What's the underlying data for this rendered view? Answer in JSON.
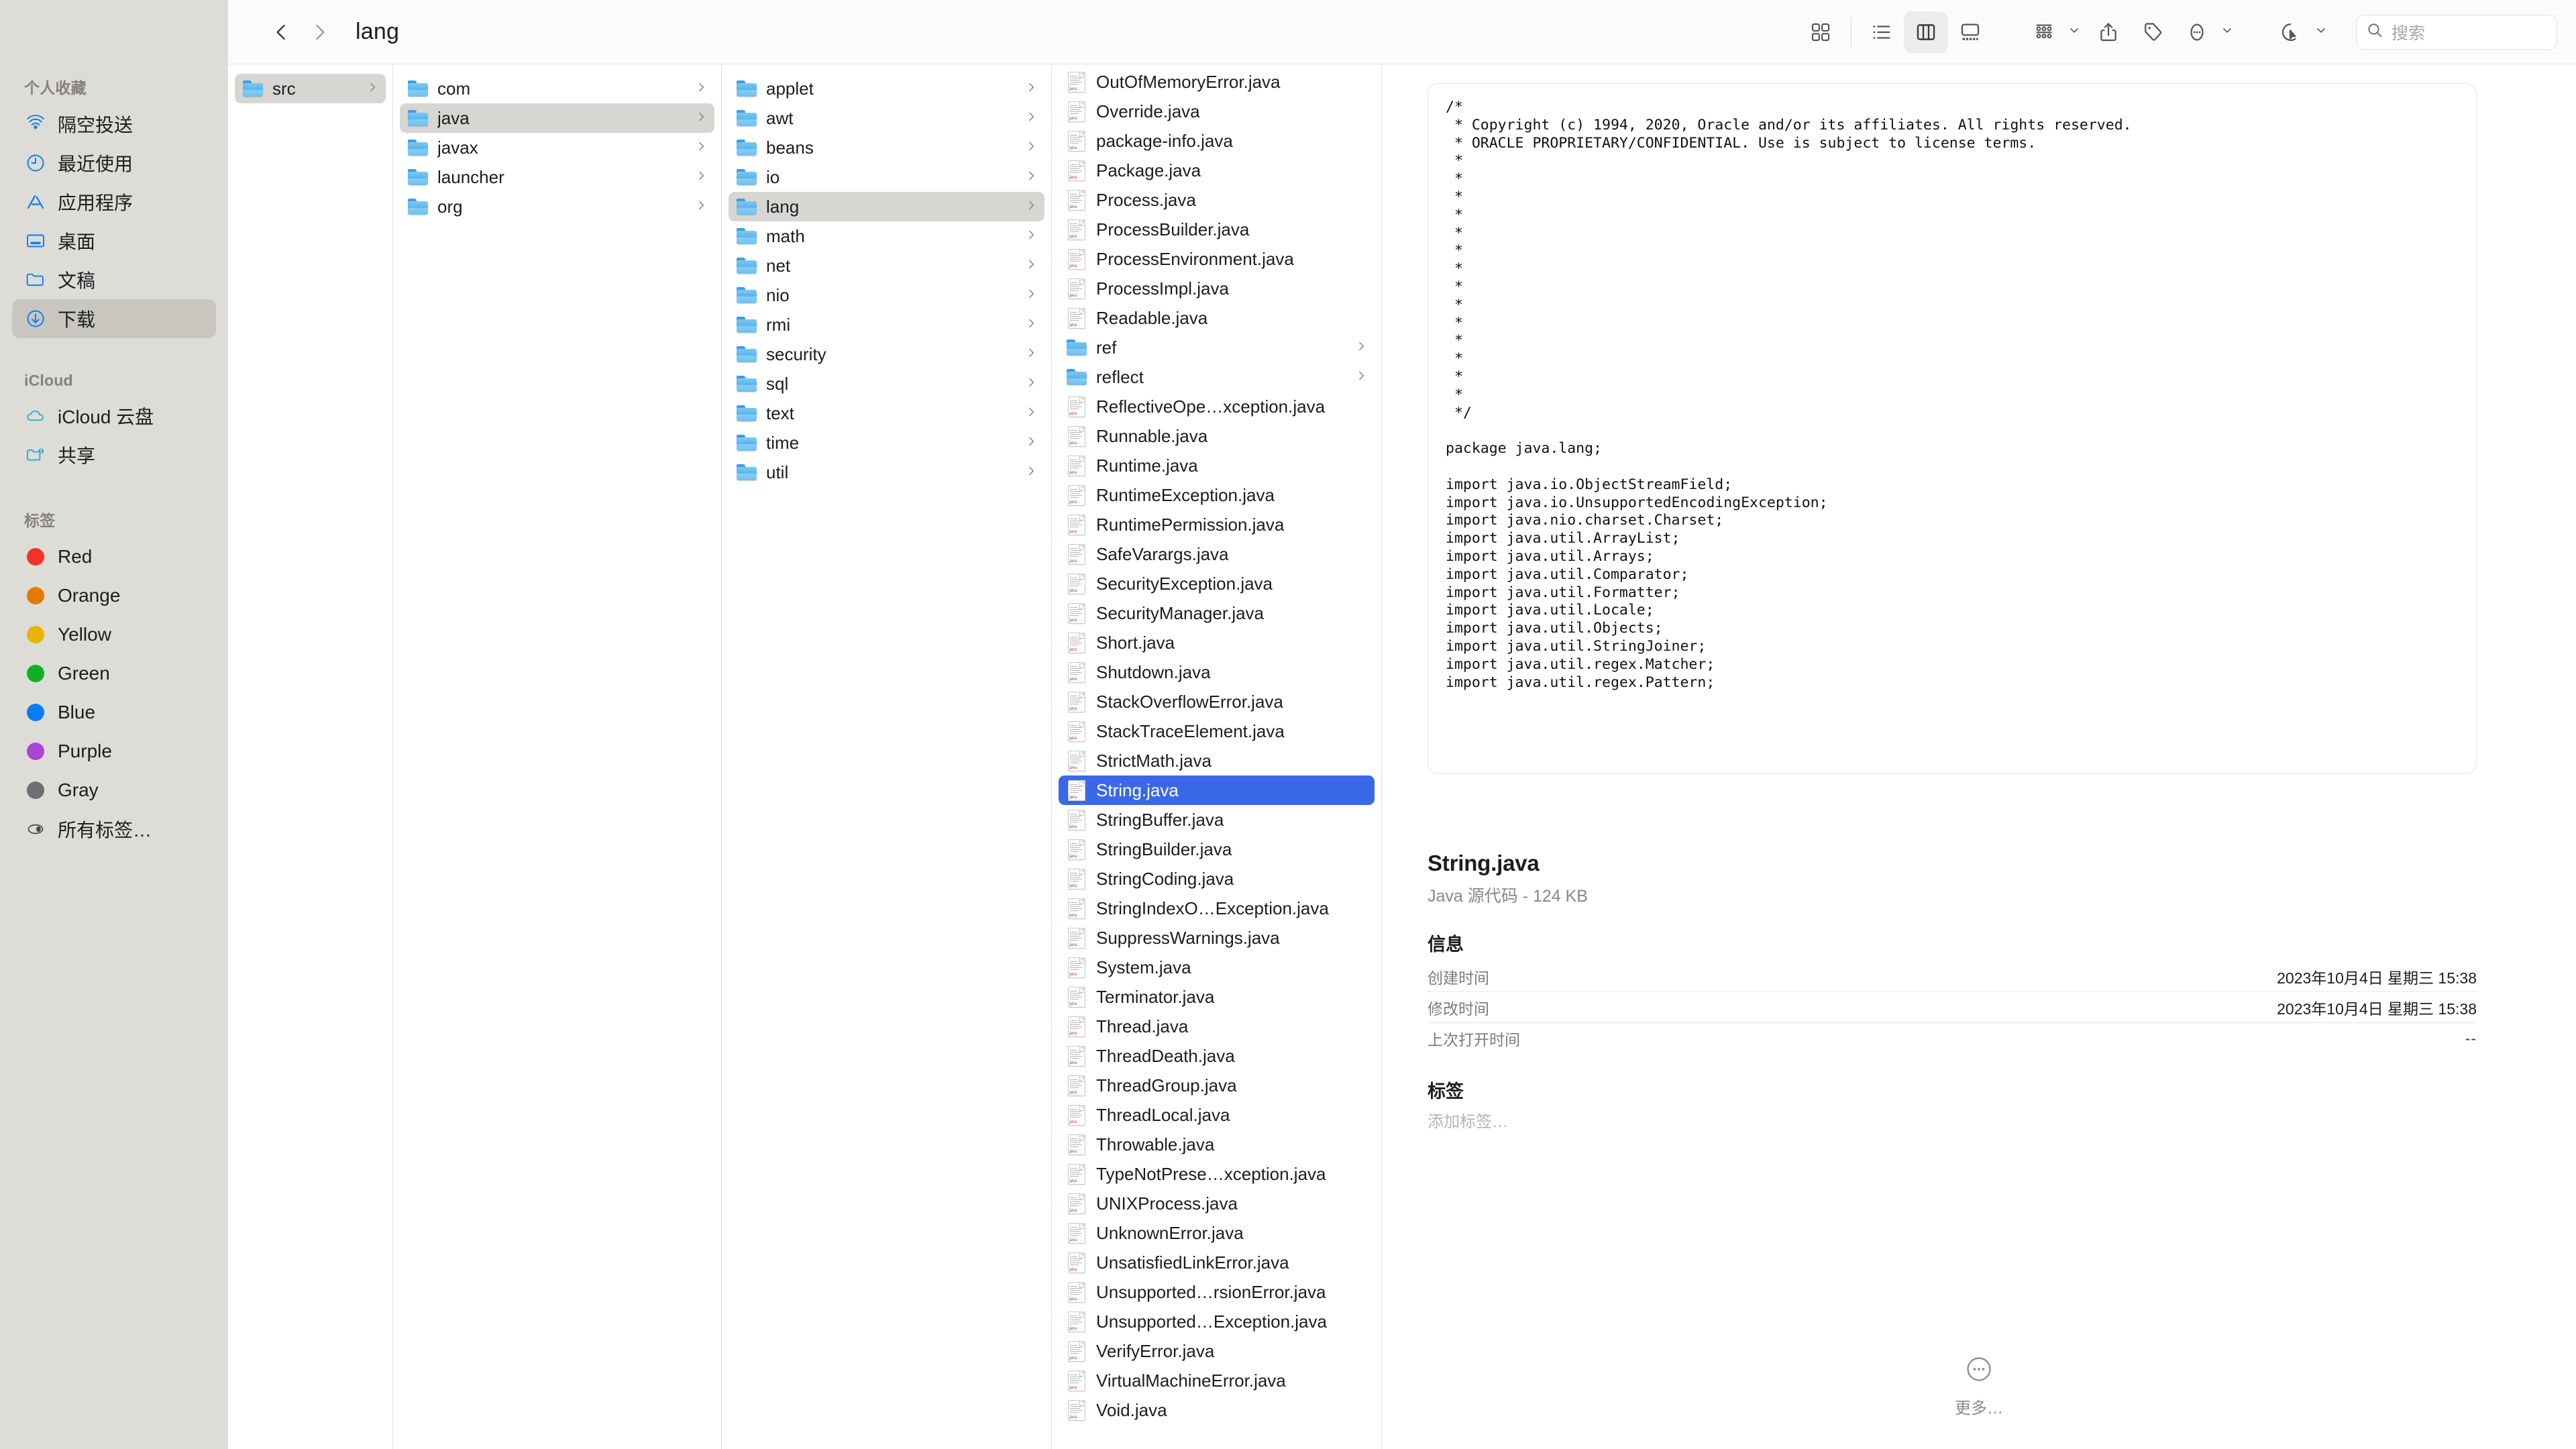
{
  "window": {
    "title": "lang"
  },
  "toolbar": {
    "back_label": "后退",
    "forward_label": "前进",
    "title": "lang",
    "view_icon_label": "图标显示方式",
    "view_list_label": "列表显示方式",
    "view_column_label": "分栏显示方式",
    "view_gallery_label": "画廊显示方式",
    "active_view": "column",
    "group_label": "分组方式",
    "share_label": "共享",
    "tag_label": "标签",
    "more_label": "更多",
    "action_label": "快速操作"
  },
  "search": {
    "placeholder": "搜索",
    "value": ""
  },
  "sidebar": {
    "sections": [
      {
        "title": "个人收藏",
        "items": [
          {
            "label": "隔空投送",
            "icon": "airdrop-icon",
            "selected": false
          },
          {
            "label": "最近使用",
            "icon": "clock-icon",
            "selected": false
          },
          {
            "label": "应用程序",
            "icon": "applications-icon",
            "selected": false
          },
          {
            "label": "桌面",
            "icon": "desktop-icon",
            "selected": false
          },
          {
            "label": "文稿",
            "icon": "documents-icon",
            "selected": false
          },
          {
            "label": "下载",
            "icon": "downloads-icon",
            "selected": true
          }
        ]
      },
      {
        "title": "iCloud",
        "items": [
          {
            "label": "iCloud 云盘",
            "icon": "cloud-icon",
            "selected": false
          },
          {
            "label": "共享",
            "icon": "shared-folder-icon",
            "selected": false
          }
        ]
      },
      {
        "title": "标签",
        "items": [
          {
            "label": "Red",
            "icon": "tag-dot",
            "color": "#f6312a",
            "selected": false
          },
          {
            "label": "Orange",
            "icon": "tag-dot",
            "color": "#e17c00",
            "selected": false
          },
          {
            "label": "Yellow",
            "icon": "tag-dot",
            "color": "#eab308",
            "selected": false
          },
          {
            "label": "Green",
            "icon": "tag-dot",
            "color": "#10b022",
            "selected": false
          },
          {
            "label": "Blue",
            "icon": "tag-dot",
            "color": "#0a7cf5",
            "selected": false
          },
          {
            "label": "Purple",
            "icon": "tag-dot",
            "color": "#a944d8",
            "selected": false
          },
          {
            "label": "Gray",
            "icon": "tag-dot",
            "color": "#6e6e73",
            "selected": false
          },
          {
            "label": "所有标签…",
            "icon": "all-tags-icon",
            "selected": false
          }
        ]
      }
    ]
  },
  "columns": [
    {
      "name": "column-0",
      "items": [
        {
          "label": "src",
          "type": "folder",
          "selected": "inactive",
          "chevron": true
        }
      ]
    },
    {
      "name": "column-1",
      "items": [
        {
          "label": "com",
          "type": "folder",
          "selected": "none",
          "chevron": true
        },
        {
          "label": "java",
          "type": "folder",
          "selected": "inactive",
          "chevron": true
        },
        {
          "label": "javax",
          "type": "folder",
          "selected": "none",
          "chevron": true
        },
        {
          "label": "launcher",
          "type": "folder",
          "selected": "none",
          "chevron": true
        },
        {
          "label": "org",
          "type": "folder",
          "selected": "none",
          "chevron": true
        }
      ]
    },
    {
      "name": "column-2",
      "items": [
        {
          "label": "applet",
          "type": "folder",
          "selected": "none",
          "chevron": true
        },
        {
          "label": "awt",
          "type": "folder",
          "selected": "none",
          "chevron": true
        },
        {
          "label": "beans",
          "type": "folder",
          "selected": "none",
          "chevron": true
        },
        {
          "label": "io",
          "type": "folder",
          "selected": "none",
          "chevron": true
        },
        {
          "label": "lang",
          "type": "folder",
          "selected": "inactive",
          "chevron": true
        },
        {
          "label": "math",
          "type": "folder",
          "selected": "none",
          "chevron": true
        },
        {
          "label": "net",
          "type": "folder",
          "selected": "none",
          "chevron": true
        },
        {
          "label": "nio",
          "type": "folder",
          "selected": "none",
          "chevron": true
        },
        {
          "label": "rmi",
          "type": "folder",
          "selected": "none",
          "chevron": true
        },
        {
          "label": "security",
          "type": "folder",
          "selected": "none",
          "chevron": true
        },
        {
          "label": "sql",
          "type": "folder",
          "selected": "none",
          "chevron": true
        },
        {
          "label": "text",
          "type": "folder",
          "selected": "none",
          "chevron": true
        },
        {
          "label": "time",
          "type": "folder",
          "selected": "none",
          "chevron": true
        },
        {
          "label": "util",
          "type": "folder",
          "selected": "none",
          "chevron": true
        }
      ]
    },
    {
      "name": "column-3",
      "scrolled": true,
      "items": [
        {
          "label": "OutOfMemoryError.java",
          "type": "java",
          "selected": "none",
          "chevron": false
        },
        {
          "label": "Override.java",
          "type": "java",
          "selected": "none",
          "chevron": false
        },
        {
          "label": "package-info.java",
          "type": "java",
          "selected": "none",
          "chevron": false
        },
        {
          "label": "Package.java",
          "type": "java",
          "selected": "none",
          "chevron": false
        },
        {
          "label": "Process.java",
          "type": "java",
          "selected": "none",
          "chevron": false
        },
        {
          "label": "ProcessBuilder.java",
          "type": "java",
          "selected": "none",
          "chevron": false
        },
        {
          "label": "ProcessEnvironment.java",
          "type": "java",
          "selected": "none",
          "chevron": false
        },
        {
          "label": "ProcessImpl.java",
          "type": "java",
          "selected": "none",
          "chevron": false
        },
        {
          "label": "Readable.java",
          "type": "java",
          "selected": "none",
          "chevron": false
        },
        {
          "label": "ref",
          "type": "folder",
          "selected": "none",
          "chevron": true
        },
        {
          "label": "reflect",
          "type": "folder",
          "selected": "none",
          "chevron": true
        },
        {
          "label": "ReflectiveOpe…xception.java",
          "type": "java",
          "selected": "none",
          "chevron": false
        },
        {
          "label": "Runnable.java",
          "type": "java",
          "selected": "none",
          "chevron": false
        },
        {
          "label": "Runtime.java",
          "type": "java",
          "selected": "none",
          "chevron": false
        },
        {
          "label": "RuntimeException.java",
          "type": "java",
          "selected": "none",
          "chevron": false
        },
        {
          "label": "RuntimePermission.java",
          "type": "java",
          "selected": "none",
          "chevron": false
        },
        {
          "label": "SafeVarargs.java",
          "type": "java",
          "selected": "none",
          "chevron": false
        },
        {
          "label": "SecurityException.java",
          "type": "java",
          "selected": "none",
          "chevron": false
        },
        {
          "label": "SecurityManager.java",
          "type": "java",
          "selected": "none",
          "chevron": false
        },
        {
          "label": "Short.java",
          "type": "java",
          "selected": "none",
          "chevron": false
        },
        {
          "label": "Shutdown.java",
          "type": "java",
          "selected": "none",
          "chevron": false
        },
        {
          "label": "StackOverflowError.java",
          "type": "java",
          "selected": "none",
          "chevron": false
        },
        {
          "label": "StackTraceElement.java",
          "type": "java",
          "selected": "none",
          "chevron": false
        },
        {
          "label": "StrictMath.java",
          "type": "java",
          "selected": "none",
          "chevron": false
        },
        {
          "label": "String.java",
          "type": "java",
          "selected": "active",
          "chevron": false
        },
        {
          "label": "StringBuffer.java",
          "type": "java",
          "selected": "none",
          "chevron": false
        },
        {
          "label": "StringBuilder.java",
          "type": "java",
          "selected": "none",
          "chevron": false
        },
        {
          "label": "StringCoding.java",
          "type": "java",
          "selected": "none",
          "chevron": false
        },
        {
          "label": "StringIndexO…Exception.java",
          "type": "java",
          "selected": "none",
          "chevron": false
        },
        {
          "label": "SuppressWarnings.java",
          "type": "java",
          "selected": "none",
          "chevron": false
        },
        {
          "label": "System.java",
          "type": "java",
          "selected": "none",
          "chevron": false
        },
        {
          "label": "Terminator.java",
          "type": "java",
          "selected": "none",
          "chevron": false
        },
        {
          "label": "Thread.java",
          "type": "java",
          "selected": "none",
          "chevron": false
        },
        {
          "label": "ThreadDeath.java",
          "type": "java",
          "selected": "none",
          "chevron": false
        },
        {
          "label": "ThreadGroup.java",
          "type": "java",
          "selected": "none",
          "chevron": false
        },
        {
          "label": "ThreadLocal.java",
          "type": "java",
          "selected": "none",
          "chevron": false
        },
        {
          "label": "Throwable.java",
          "type": "java",
          "selected": "none",
          "chevron": false
        },
        {
          "label": "TypeNotPrese…xception.java",
          "type": "java",
          "selected": "none",
          "chevron": false
        },
        {
          "label": "UNIXProcess.java",
          "type": "java",
          "selected": "none",
          "chevron": false
        },
        {
          "label": "UnknownError.java",
          "type": "java",
          "selected": "none",
          "chevron": false
        },
        {
          "label": "UnsatisfiedLinkError.java",
          "type": "java",
          "selected": "none",
          "chevron": false
        },
        {
          "label": "Unsupported…rsionError.java",
          "type": "java",
          "selected": "none",
          "chevron": false
        },
        {
          "label": "Unsupported…Exception.java",
          "type": "java",
          "selected": "none",
          "chevron": false
        },
        {
          "label": "VerifyError.java",
          "type": "java",
          "selected": "none",
          "chevron": false
        },
        {
          "label": "VirtualMachineError.java",
          "type": "java",
          "selected": "none",
          "chevron": false
        },
        {
          "label": "Void.java",
          "type": "java",
          "selected": "none",
          "chevron": false
        }
      ]
    }
  ],
  "preview": {
    "code": "/*\n * Copyright (c) 1994, 2020, Oracle and/or its affiliates. All rights reserved.\n * ORACLE PROPRIETARY/CONFIDENTIAL. Use is subject to license terms.\n *\n *\n *\n *\n *\n *\n *\n *\n *\n *\n *\n *\n *\n *\n */\n\npackage java.lang;\n\nimport java.io.ObjectStreamField;\nimport java.io.UnsupportedEncodingException;\nimport java.nio.charset.Charset;\nimport java.util.ArrayList;\nimport java.util.Arrays;\nimport java.util.Comparator;\nimport java.util.Formatter;\nimport java.util.Locale;\nimport java.util.Objects;\nimport java.util.StringJoiner;\nimport java.util.regex.Matcher;\nimport java.util.regex.Pattern;",
    "filename": "String.java",
    "kind_and_size": "Java 源代码 - 124 KB",
    "info_heading": "信息",
    "rows": [
      {
        "key": "创建时间",
        "value": "2023年10月4日 星期三 15:38"
      },
      {
        "key": "修改时间",
        "value": "2023年10月4日 星期三 15:38"
      },
      {
        "key": "上次打开时间",
        "value": "--"
      }
    ],
    "tags_heading": "标签",
    "tags_placeholder": "添加标签…",
    "more_label": "更多…"
  }
}
